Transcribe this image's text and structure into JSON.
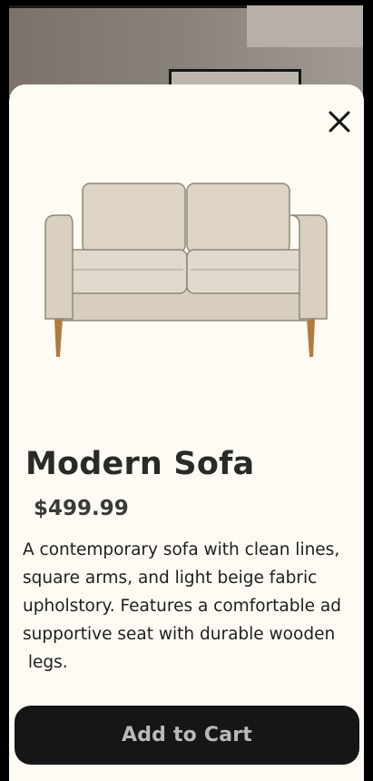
{
  "product": {
    "name": "Modern Sofa",
    "price": "$499.99",
    "description": "A contemporary sofa with clean lines,\nsquare arms, and light beige fabric\nupholstory. Features a comfortable ad\nsupportive seat with durable wooden\n legs.",
    "image_icon": "sofa-image"
  },
  "actions": {
    "add_to_cart_label": "Add to Cart",
    "close_icon": "close-icon"
  },
  "colors": {
    "sheet_background": "#fdfbf3",
    "button_background": "#161616",
    "button_text": "#b9b9b9",
    "sofa_fabric": "#d9d0c1",
    "sofa_legs": "#b07a3c"
  }
}
